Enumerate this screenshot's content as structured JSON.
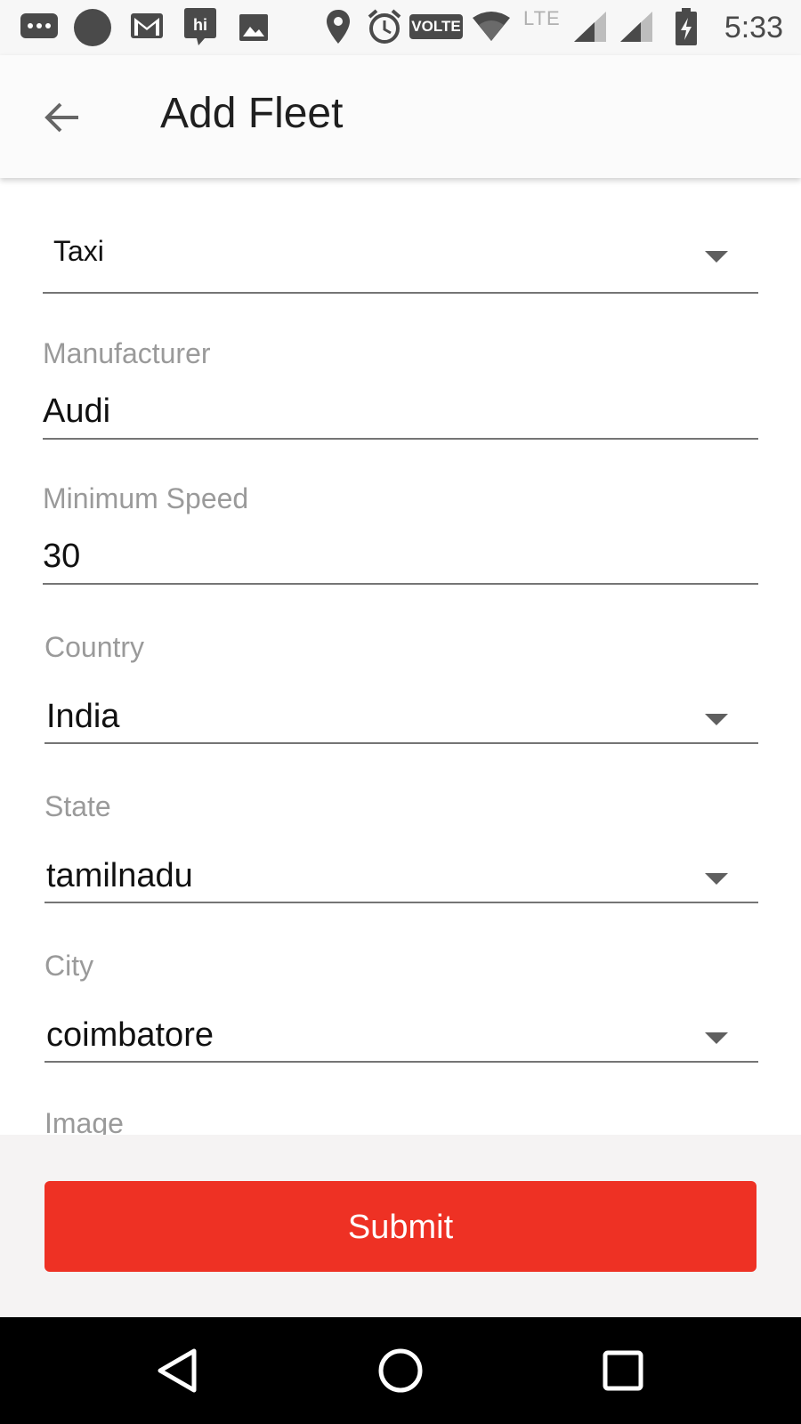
{
  "status_bar": {
    "time": "5:33",
    "volte": "VOLTE",
    "network": "LTE",
    "icons": [
      "messages-icon",
      "circle-notification-icon",
      "gmail-icon",
      "hike-icon",
      "gallery-icon",
      "location-icon",
      "alarm-icon",
      "volte-icon",
      "wifi-icon",
      "signal-icon",
      "signal-icon",
      "battery-charging-icon"
    ]
  },
  "app_bar": {
    "title": "Add Fleet",
    "back_icon": "arrow-back-icon"
  },
  "form": {
    "vehicle_type": {
      "value": "Taxi"
    },
    "manufacturer": {
      "label": "Manufacturer",
      "value": "Audi"
    },
    "minimum_speed": {
      "label": "Minimum Speed",
      "value": "30"
    },
    "country": {
      "label": "Country",
      "value": "India"
    },
    "state": {
      "label": "State",
      "value": "tamilnadu"
    },
    "city": {
      "label": "City",
      "value": "coimbatore"
    },
    "image": {
      "label": "Image"
    }
  },
  "submit": {
    "label": "Submit"
  },
  "colors": {
    "accent": "#ee3124",
    "label": "#9a9a9a",
    "underline": "#757575"
  },
  "nav_bar": {
    "icons": [
      "back-triangle-icon",
      "home-circle-icon",
      "recents-square-icon"
    ]
  }
}
